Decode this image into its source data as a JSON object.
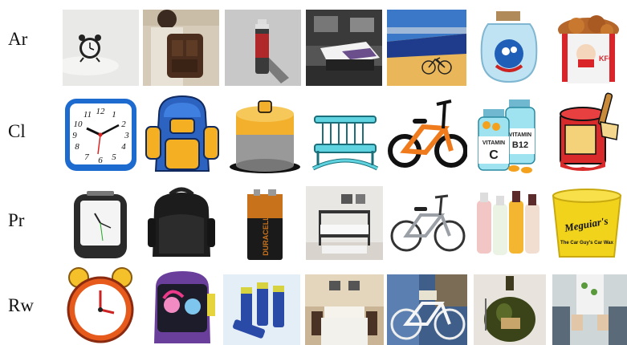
{
  "rows": [
    {
      "label": "Ar"
    },
    {
      "label": "Cl"
    },
    {
      "label": "Pr"
    },
    {
      "label": "Rw"
    }
  ],
  "texts": {
    "cl_vitamin_left": "VITAMIN",
    "cl_vitamin_left_letter": "C",
    "cl_vitamin_right": "VITAMIN",
    "cl_vitamin_right_letter": "B12",
    "pr_battery_brand": "DURACELL",
    "pr_bucket_brand": "Meguiar's",
    "pr_bucket_slogan": "The Car Guy's Car Wax",
    "ar_bucket_brand": "KFC",
    "cl_clock_numbers": [
      "12",
      "1",
      "2",
      "3",
      "4",
      "5",
      "6",
      "7",
      "8",
      "9",
      "10",
      "11"
    ]
  }
}
